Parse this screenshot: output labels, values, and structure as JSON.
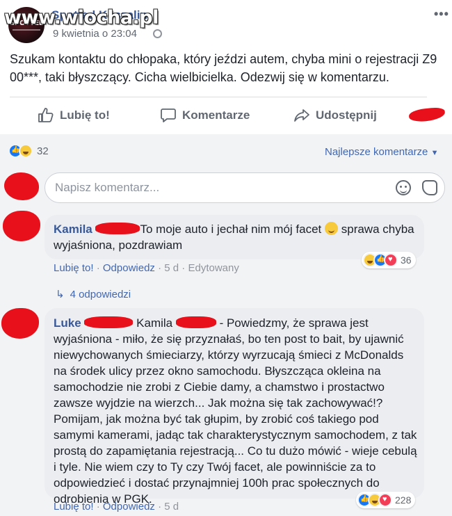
{
  "header": {
    "watermark": "www.wiocha.pl",
    "page_name": "Spotted Koszalin",
    "avatar_text": "SPOTTED",
    "timestamp": "9 kwietnia o 23:04"
  },
  "post": {
    "text": "Szukam kontaktu do chłopaka, który jeździ autem, chyba mini o rejestracji Z9 00***, taki błyszczący. Cicha wielbicielka. Odezwij się w komentarzu."
  },
  "actions": {
    "like": "Lubię to!",
    "comment": "Komentarze",
    "share": "Udostępnij"
  },
  "summary": {
    "reaction_count": "32",
    "sort_label": "Najlepsze komentarze"
  },
  "composer": {
    "placeholder": "Napisz komentarz..."
  },
  "comments": [
    {
      "author": "Kamila",
      "text_before_emoji": "To moje auto i jechał nim mój facet",
      "text_after_emoji": " sprawa chyba wyjaśniona, pozdrawiam",
      "like": "Lubię to!",
      "reply": "Odpowiedz",
      "time": "5 d",
      "edited": "Edytowany",
      "reaction_count": "36",
      "replies": "4 odpowiedzi"
    },
    {
      "author": "Luke",
      "mention": "Kamila",
      "text": " - Powiedzmy, że sprawa jest wyjaśniona - miło, że się przyznałaś, bo ten post to bait, by ujawnić niewychowanych śmieciarzy, którzy wyrzucają śmieci z McDonalds na środek ulicy przez okno samochodu. Błyszcząca okleina na samochodzie nie zrobi z Ciebie damy, a chamstwo i prostactwo zawsze wyjdzie na wierzch... Jak można się tak zachowywać!? Pomijam, jak można być tak głupim, by zrobić coś takiego pod samymi kamerami, jadąc tak charakterystycznym samochodem, z tak prostą do zapamiętania rejestracją... Co tu dużo mówić - wieje cebulą i tyle. Nie wiem czy to Ty czy Twój facet, ale powinniście za to odpowiedzieć i dostać przynajmniej 100h prac społecznych do odrobienia w PGK.",
      "like": "Lubię to!",
      "reply": "Odpowiedz",
      "time": "5 d",
      "reaction_count": "228"
    }
  ],
  "colors": {
    "link": "#385898",
    "accent": "#4267b2",
    "redaction": "#e8101a",
    "bubble": "#ebedf0"
  }
}
